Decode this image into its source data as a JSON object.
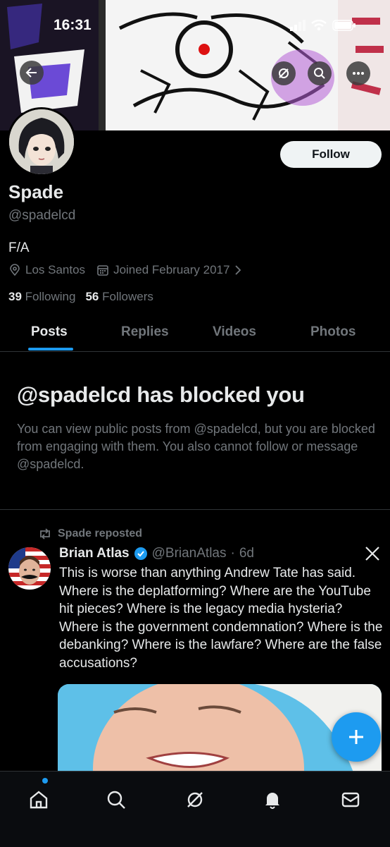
{
  "status": {
    "time": "16:31"
  },
  "profile": {
    "name": "Spade",
    "handle": "@spadelcd",
    "bio": "F/A",
    "location": "Los Santos",
    "joined": "Joined February 2017",
    "following_count": "39",
    "following_label": "Following",
    "followers_count": "56",
    "followers_label": "Followers",
    "follow_label": "Follow"
  },
  "tabs": [
    {
      "label": "Posts",
      "active": true
    },
    {
      "label": "Replies"
    },
    {
      "label": "Videos"
    },
    {
      "label": "Photos"
    }
  ],
  "blocked": {
    "title": "@spadelcd has blocked you",
    "text": "You can view public posts from @spadelcd, but you are blocked from engaging with them. You also cannot follow or message @spadelcd."
  },
  "post": {
    "repost_label": "Spade reposted",
    "author_name": "Brian Atlas",
    "author_handle": "@BrianAtlas",
    "time": "6d",
    "text": "This is worse than anything Andrew Tate has said. Where is the deplatforming? Where are the YouTube hit pieces? Where is the legacy media hysteria? Where is the government condemnation? Where is the debanking? Where is the lawfare? Where are the false accusations?"
  },
  "nav": [
    "home-icon",
    "search-icon",
    "grok-icon",
    "notifications-icon",
    "messages-icon"
  ],
  "colors": {
    "accent": "#1d9bf0",
    "background": "#000000",
    "muted": "#71767b"
  }
}
